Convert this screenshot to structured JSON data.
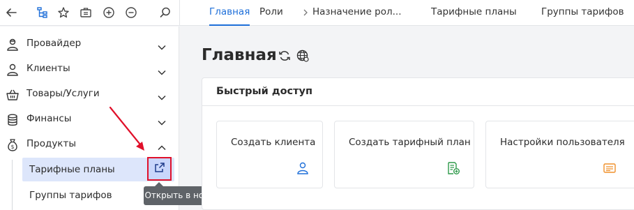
{
  "topbar": {
    "icons": [
      "back-arrow-icon",
      "tree-structure-icon",
      "star-icon",
      "briefcase-icon",
      "plus-circle-icon",
      "minus-circle-icon",
      "search-icon"
    ],
    "tabs": [
      {
        "label": "Главная",
        "active": true
      },
      {
        "label": "Роли",
        "active": false
      },
      {
        "label": "Назначение рол...",
        "active": false
      },
      {
        "label": "Тарифные планы",
        "active": false
      },
      {
        "label": "Группы тарифов",
        "active": false
      }
    ]
  },
  "sidebar": {
    "items": [
      {
        "label": "Провайдер",
        "icon": "provider-person-icon",
        "expanded": false
      },
      {
        "label": "Клиенты",
        "icon": "clients-person-icon",
        "expanded": false
      },
      {
        "label": "Товары/Услуги",
        "icon": "basket-icon",
        "expanded": false
      },
      {
        "label": "Финансы",
        "icon": "coins-icon",
        "expanded": false
      },
      {
        "label": "Продукты",
        "icon": "money-bag-icon",
        "expanded": true
      }
    ],
    "sub_items": [
      {
        "label": "Тарифные планы",
        "selected": true
      },
      {
        "label": "Группы тарифов",
        "selected": false
      }
    ],
    "open_new_tab_icon": "external-link-icon"
  },
  "tooltip": {
    "text": "Открыть в новой вкладке"
  },
  "main": {
    "title": "Главная",
    "title_icons": [
      "refresh-icon",
      "globe-icon"
    ],
    "quick_access": {
      "title": "Быстрый доступ",
      "cards": [
        {
          "label": "Создать клиента",
          "icon": "user-add-icon",
          "icon_color": "#1e6fd9"
        },
        {
          "label": "Создать тарифный план",
          "icon": "document-add-icon",
          "icon_color": "#2e9a4a"
        },
        {
          "label": "Настройки пользователя",
          "icon": "settings-card-icon",
          "icon_color": "#f0902a"
        }
      ]
    }
  },
  "colors": {
    "accent": "#1e6fd9",
    "highlight_border": "#e0102a",
    "selected_bg": "#dde6fb",
    "tooltip_bg": "#5f6368"
  }
}
